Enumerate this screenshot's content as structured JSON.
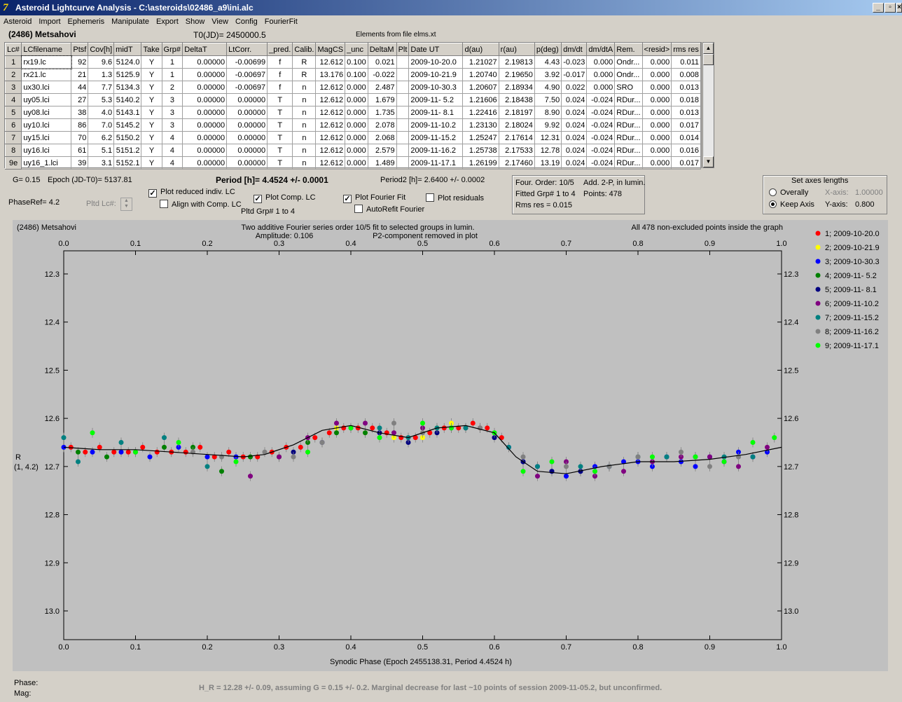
{
  "window": {
    "title": "Asteroid Lightcurve Analysis - C:\\asteroids\\02486_a9\\ini.alc",
    "minimize": "_",
    "restore": "▫",
    "close": "×"
  },
  "menu": [
    "Asteroid",
    "Import",
    "Ephemeris",
    "Manipulate",
    "Export",
    "Show",
    "View",
    "Config",
    "FourierFit"
  ],
  "header": {
    "asteroid": "(2486) Metsahovi",
    "t0": "T0(JD)= 2450000.5",
    "elements": "Elements from file elms.xt"
  },
  "table": {
    "columns": [
      "Lc#",
      "LCfilename",
      "Ptsf",
      "Cov[h]",
      "midT",
      "Take",
      "Grp#",
      "DeltaT",
      "LtCorr.",
      "_pred.",
      "Calib.",
      "MagCS",
      "_unc",
      "DeltaM",
      "Plt",
      "Date UT",
      "d(au)",
      "r(au)",
      "p(deg)",
      "dm/dt",
      "dm/dtA",
      "Rem.",
      "<resid>",
      "rms res"
    ],
    "rows": [
      [
        "1",
        "rx19.lc",
        "92",
        "9.6",
        "5124.0",
        "Y",
        "1",
        "0.00000",
        "-0.00699",
        "f",
        "R",
        "12.612",
        "0.100",
        "0.021",
        "",
        "2009-10-20.0",
        "1.21027",
        "2.19813",
        "4.43",
        "-0.023",
        "0.000",
        "Ondr...",
        "0.000",
        "0.011"
      ],
      [
        "2",
        "rx21.lc",
        "21",
        "1.3",
        "5125.9",
        "Y",
        "1",
        "0.00000",
        "-0.00697",
        "f",
        "R",
        "13.176",
        "0.100",
        "-0.022",
        "",
        "2009-10-21.9",
        "1.20740",
        "2.19650",
        "3.92",
        "-0.017",
        "0.000",
        "Ondr...",
        "0.000",
        "0.008"
      ],
      [
        "3",
        "ux30.lci",
        "44",
        "7.7",
        "5134.3",
        "Y",
        "2",
        "0.00000",
        "-0.00697",
        "f",
        "n",
        "12.612",
        "0.000",
        "2.487",
        "",
        "2009-10-30.3",
        "1.20607",
        "2.18934",
        "4.90",
        "0.022",
        "0.000",
        "SRO",
        "0.000",
        "0.013"
      ],
      [
        "4",
        "uy05.lci",
        "27",
        "5.3",
        "5140.2",
        "Y",
        "3",
        "0.00000",
        "0.00000",
        "T",
        "n",
        "12.612",
        "0.000",
        "1.679",
        "",
        "2009-11- 5.2",
        "1.21606",
        "2.18438",
        "7.50",
        "0.024",
        "-0.024",
        "RDur...",
        "0.000",
        "0.018"
      ],
      [
        "5",
        "uy08.lci",
        "38",
        "4.0",
        "5143.1",
        "Y",
        "3",
        "0.00000",
        "0.00000",
        "T",
        "n",
        "12.612",
        "0.000",
        "1.735",
        "",
        "2009-11- 8.1",
        "1.22416",
        "2.18197",
        "8.90",
        "0.024",
        "-0.024",
        "RDur...",
        "0.000",
        "0.013"
      ],
      [
        "6",
        "uy10.lci",
        "86",
        "7.0",
        "5145.2",
        "Y",
        "3",
        "0.00000",
        "0.00000",
        "T",
        "n",
        "12.612",
        "0.000",
        "2.078",
        "",
        "2009-11-10.2",
        "1.23130",
        "2.18024",
        "9.92",
        "0.024",
        "-0.024",
        "RDur...",
        "0.000",
        "0.017"
      ],
      [
        "7",
        "uy15.lci",
        "70",
        "6.2",
        "5150.2",
        "Y",
        "4",
        "0.00000",
        "0.00000",
        "T",
        "n",
        "12.612",
        "0.000",
        "2.068",
        "",
        "2009-11-15.2",
        "1.25247",
        "2.17614",
        "12.31",
        "0.024",
        "-0.024",
        "RDur...",
        "0.000",
        "0.014"
      ],
      [
        "8",
        "uy16.lci",
        "61",
        "5.1",
        "5151.2",
        "Y",
        "4",
        "0.00000",
        "0.00000",
        "T",
        "n",
        "12.612",
        "0.000",
        "2.579",
        "",
        "2009-11-16.2",
        "1.25738",
        "2.17533",
        "12.78",
        "0.024",
        "-0.024",
        "RDur...",
        "0.000",
        "0.016"
      ],
      [
        "9e",
        "uy16_1.lci",
        "39",
        "3.1",
        "5152.1",
        "Y",
        "4",
        "0.00000",
        "0.00000",
        "T",
        "n",
        "12.612",
        "0.000",
        "1.489",
        "",
        "2009-11-17.1",
        "1.26199",
        "2.17460",
        "13.19",
        "0.024",
        "-0.024",
        "RDur...",
        "0.000",
        "0.017"
      ]
    ]
  },
  "controls": {
    "g": "G= 0.15",
    "epoch": "Epoch (JD-T0)= 5137.81",
    "period": "Period [h]= 4.4524 +/- 0.0001",
    "period2": "Period2 [h]= 2.6400 +/- 0.0002",
    "phaseref": "PhaseRef= 4.2",
    "pltd_lc": "Pltd Lc#:",
    "plot_reduced": "Plot reduced indiv. LC",
    "align_comp": "Align with Comp. LC",
    "plot_comp": "Plot Comp. LC",
    "pltd_grp": "Pltd Grp#  1   to   4",
    "plot_fourier": "Plot Fourier Fit",
    "autorefit": "AutoRefit Fourier",
    "plot_residuals": "Plot residuals",
    "fourier_info": {
      "order": "Four. Order: 10/5",
      "add": "Add. 2-P, in lumin.",
      "fitted": "Fitted Grp# 1 to 4",
      "points": "Points: 478",
      "rms": "Rms res     = 0.015"
    },
    "axes": {
      "title": "Set axes lengths",
      "overally": "Overally",
      "keep_axis": "Keep Axis",
      "xaxis_label": "X-axis:",
      "xaxis_val": "1.00000",
      "yaxis_label": "Y-axis:",
      "yaxis_val": "0.800"
    }
  },
  "plot": {
    "top_left": "(2486) Metsahovi",
    "top_center1": "Two additive Fourier series order 10/5 fit to selected groups in lumin.",
    "top_center2a": "Amplitude: 0.106",
    "top_center2b": "P2-component removed in plot",
    "top_right": "All 478 non-excluded points inside the graph",
    "ylabel1": "R",
    "ylabel2": "(1, 4.2)",
    "xlabel": "Synodic Phase (Epoch 2455138.31, Period 4.4524 h)"
  },
  "chart_data": {
    "type": "scatter",
    "title": "Two additive Fourier series order 10/5 fit to selected groups in lumin.",
    "xlabel": "Synodic Phase (Epoch 2455138.31, Period 4.4524 h)",
    "ylabel": "R (1, 4.2)",
    "xlim": [
      0.0,
      1.0
    ],
    "ylim": [
      13.06,
      12.26
    ],
    "y_inverted": true,
    "xticks": [
      "0.0",
      "0.1",
      "0.2",
      "0.3",
      "0.4",
      "0.5",
      "0.6",
      "0.7",
      "0.8",
      "0.9",
      "1.0"
    ],
    "yticks": [
      "12.3",
      "12.4",
      "12.5",
      "12.6",
      "12.7",
      "12.8",
      "12.9",
      "13.0"
    ],
    "fit_curve": {
      "x": [
        0.0,
        0.05,
        0.1,
        0.15,
        0.2,
        0.25,
        0.28,
        0.32,
        0.36,
        0.4,
        0.44,
        0.48,
        0.52,
        0.56,
        0.6,
        0.63,
        0.66,
        0.7,
        0.75,
        0.8,
        0.85,
        0.9,
        0.95,
        1.0
      ],
      "y": [
        12.66,
        12.665,
        12.665,
        12.67,
        12.675,
        12.68,
        12.675,
        12.655,
        12.625,
        12.615,
        12.63,
        12.64,
        12.62,
        12.615,
        12.63,
        12.68,
        12.71,
        12.715,
        12.7,
        12.69,
        12.69,
        12.685,
        12.675,
        12.66
      ]
    },
    "series": [
      {
        "name": "1; 2009-10-20.0",
        "color": "#ff0000",
        "x": [
          0.01,
          0.03,
          0.05,
          0.07,
          0.09,
          0.11,
          0.13,
          0.15,
          0.17,
          0.19,
          0.21,
          0.23,
          0.25,
          0.27,
          0.29,
          0.31,
          0.33,
          0.35,
          0.37,
          0.39,
          0.41,
          0.43,
          0.45,
          0.47,
          0.49,
          0.51,
          0.53,
          0.55,
          0.57,
          0.59,
          0.61
        ],
        "y": [
          12.66,
          12.67,
          12.66,
          12.67,
          12.67,
          12.66,
          12.67,
          12.67,
          12.67,
          12.66,
          12.68,
          12.67,
          12.68,
          12.68,
          12.67,
          12.66,
          12.66,
          12.64,
          12.63,
          12.62,
          12.62,
          12.62,
          12.63,
          12.64,
          12.64,
          12.63,
          12.62,
          12.62,
          12.61,
          12.62,
          12.64
        ]
      },
      {
        "name": "2; 2009-10-21.9",
        "color": "#ffff00",
        "x": [
          0.38,
          0.42,
          0.46,
          0.5,
          0.52,
          0.54,
          0.56,
          0.58
        ],
        "y": [
          12.62,
          12.63,
          12.64,
          12.64,
          12.62,
          12.61,
          12.62,
          12.62
        ]
      },
      {
        "name": "3; 2009-10-30.3",
        "color": "#0000ff",
        "x": [
          0.0,
          0.04,
          0.08,
          0.12,
          0.16,
          0.2,
          0.24,
          0.62,
          0.64,
          0.66,
          0.68,
          0.7,
          0.72,
          0.74,
          0.76,
          0.78,
          0.8,
          0.82,
          0.84,
          0.86,
          0.88,
          0.9,
          0.92,
          0.94,
          0.96,
          0.98
        ],
        "y": [
          12.66,
          12.67,
          12.67,
          12.68,
          12.66,
          12.68,
          12.68,
          12.66,
          12.69,
          12.7,
          12.71,
          12.72,
          12.71,
          12.7,
          12.7,
          12.69,
          12.69,
          12.7,
          12.68,
          12.69,
          12.7,
          12.68,
          12.69,
          12.67,
          12.68,
          12.67
        ]
      },
      {
        "name": "4; 2009-11- 5.2",
        "color": "#008000",
        "x": [
          0.02,
          0.06,
          0.1,
          0.14,
          0.18,
          0.22,
          0.26,
          0.3,
          0.34,
          0.38,
          0.42
        ],
        "y": [
          12.67,
          12.68,
          12.67,
          12.66,
          12.66,
          12.71,
          12.68,
          12.68,
          12.65,
          12.63,
          12.63
        ]
      },
      {
        "name": "5; 2009-11- 8.1",
        "color": "#000080",
        "x": [
          0.32,
          0.36,
          0.4,
          0.44,
          0.48,
          0.52,
          0.56,
          0.6,
          0.64,
          0.68,
          0.72
        ],
        "y": [
          12.67,
          12.65,
          12.62,
          12.63,
          12.65,
          12.63,
          12.62,
          12.64,
          12.69,
          12.71,
          12.71
        ]
      },
      {
        "name": "6; 2009-11-10.2",
        "color": "#800080",
        "x": [
          0.26,
          0.3,
          0.34,
          0.38,
          0.42,
          0.46,
          0.5,
          0.54,
          0.58,
          0.66,
          0.7,
          0.74,
          0.78,
          0.82,
          0.86,
          0.9,
          0.94,
          0.98
        ],
        "y": [
          12.72,
          12.68,
          12.64,
          12.61,
          12.61,
          12.63,
          12.62,
          12.62,
          12.62,
          12.72,
          12.69,
          12.72,
          12.71,
          12.69,
          12.68,
          12.68,
          12.7,
          12.66
        ]
      },
      {
        "name": "7; 2009-11-15.2",
        "color": "#008080",
        "x": [
          0.0,
          0.02,
          0.08,
          0.14,
          0.2,
          0.44,
          0.48,
          0.52,
          0.56,
          0.62,
          0.66,
          0.72,
          0.76,
          0.8,
          0.84,
          0.88,
          0.92,
          0.96
        ],
        "y": [
          12.64,
          12.69,
          12.65,
          12.64,
          12.7,
          12.62,
          12.64,
          12.62,
          12.62,
          12.66,
          12.7,
          12.7,
          12.7,
          12.68,
          12.68,
          12.68,
          12.68,
          12.68
        ]
      },
      {
        "name": "8; 2009-11-16.2",
        "color": "#808080",
        "x": [
          0.18,
          0.22,
          0.28,
          0.32,
          0.36,
          0.46,
          0.5,
          0.54,
          0.58,
          0.64,
          0.7,
          0.76,
          0.8,
          0.86,
          0.9,
          0.94
        ],
        "y": [
          12.67,
          12.68,
          12.67,
          12.68,
          12.65,
          12.61,
          12.63,
          12.62,
          12.62,
          12.68,
          12.7,
          12.7,
          12.68,
          12.67,
          12.7,
          12.68
        ]
      },
      {
        "name": "9; 2009-11-17.1",
        "color": "#00ff00",
        "x": [
          0.04,
          0.1,
          0.16,
          0.24,
          0.34,
          0.4,
          0.44,
          0.5,
          0.54,
          0.6,
          0.64,
          0.68,
          0.74,
          0.82,
          0.88,
          0.92,
          0.96,
          0.99
        ],
        "y": [
          12.63,
          12.67,
          12.65,
          12.69,
          12.67,
          12.62,
          12.64,
          12.61,
          12.62,
          12.63,
          12.71,
          12.69,
          12.71,
          12.68,
          12.68,
          12.69,
          12.65,
          12.64
        ]
      }
    ],
    "legend": "right"
  },
  "status": {
    "phase": "Phase:",
    "mag": "Mag:",
    "note": "H_R = 12.28 +/- 0.09, assuming G = 0.15 +/- 0.2. Marginal decrease for last ~10 points of session 2009-11-05.2, but unconfirmed."
  }
}
